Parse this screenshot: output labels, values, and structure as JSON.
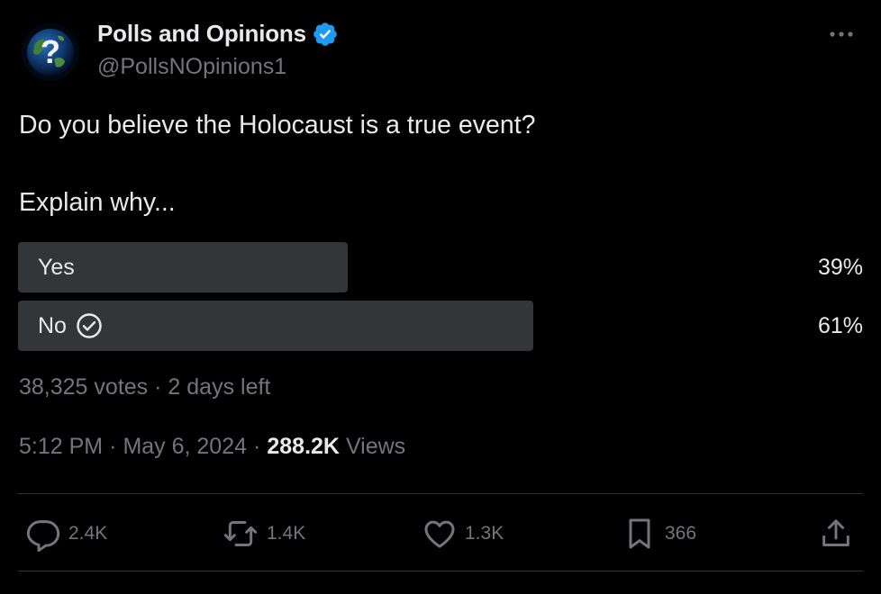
{
  "account": {
    "display_name": "Polls and Opinions",
    "handle": "@PollsNOpinions1",
    "verified": true
  },
  "tweet": {
    "text": "Do you believe the Holocaust is a true event?\n\nExplain why..."
  },
  "poll": {
    "options": [
      {
        "label": "Yes",
        "percent_label": "39%",
        "percent": 39,
        "selected": false
      },
      {
        "label": "No",
        "percent_label": "61%",
        "percent": 61,
        "selected": true
      }
    ],
    "votes": "38,325 votes",
    "separator": "·",
    "time_left": "2 days left"
  },
  "meta": {
    "time": "5:12 PM",
    "separator": "·",
    "date": "May 6, 2024",
    "views_count": "288.2K",
    "views_label": "Views"
  },
  "actions": {
    "replies": "2.4K",
    "reposts": "1.4K",
    "likes": "1.3K",
    "bookmarks": "366"
  },
  "colors": {
    "background": "#000000",
    "text_primary": "#e7e9ea",
    "text_secondary": "#71767b",
    "poll_bar": "#333639",
    "verified_badge": "#1d9bf0",
    "divider": "#2f3336"
  },
  "icons": [
    "globe-avatar-icon",
    "verified-badge-icon",
    "more-options-icon",
    "check-circle-icon",
    "reply-icon",
    "repost-icon",
    "like-icon",
    "bookmark-icon",
    "share-icon"
  ]
}
